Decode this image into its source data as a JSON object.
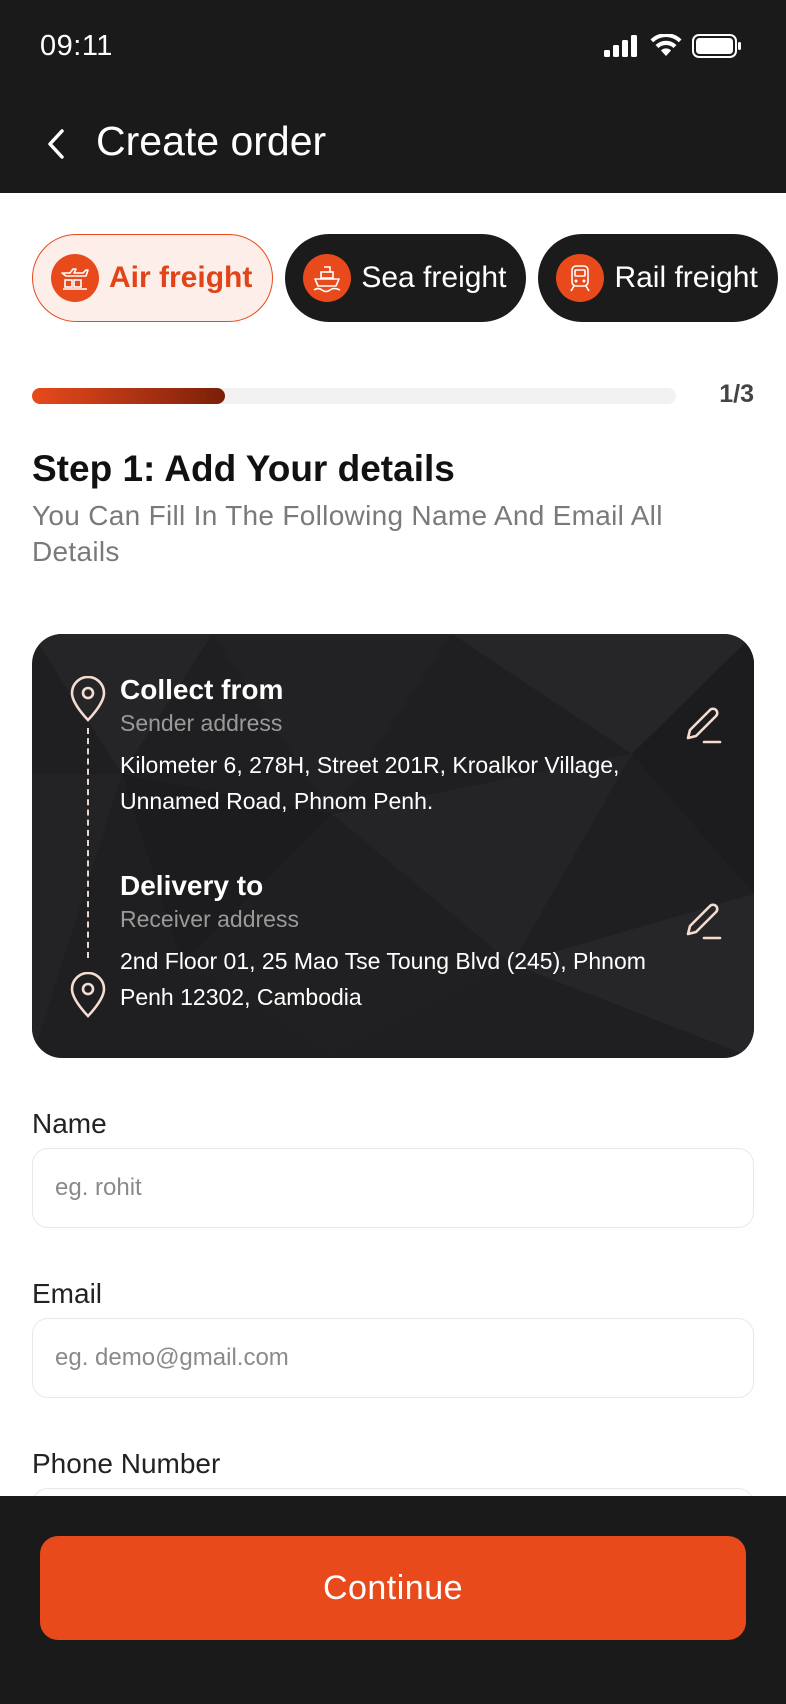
{
  "status_bar": {
    "time": "09:11"
  },
  "header": {
    "title": "Create order"
  },
  "tabs": [
    {
      "label": "Air freight",
      "active": true,
      "icon": "airplane-cargo-icon"
    },
    {
      "label": "Sea freight",
      "active": false,
      "icon": "ship-icon"
    },
    {
      "label": "Rail freight",
      "active": false,
      "icon": "train-icon"
    }
  ],
  "progress": {
    "text": "1/3",
    "fraction": 0.3
  },
  "step": {
    "title": "Step 1:  Add Your details",
    "subtitle": "You Can Fill In The Following Name And Email All Details"
  },
  "address": {
    "collect": {
      "heading": "Collect from",
      "label": "Sender address",
      "text": "Kilometer 6, 278H, Street 201R, Kroalkor Village, Unnamed Road, Phnom Penh."
    },
    "delivery": {
      "heading": "Delivery to",
      "label": "Receiver address",
      "text": "2nd Floor 01, 25 Mao Tse Toung Blvd (245), Phnom Penh 12302, Cambodia"
    }
  },
  "form": {
    "name": {
      "label": "Name",
      "placeholder": "eg. rohit"
    },
    "email": {
      "label": "Email",
      "placeholder": "eg. demo@gmail.com"
    },
    "phone": {
      "label": "Phone Number"
    }
  },
  "footer": {
    "continue_label": "Continue"
  },
  "colors": {
    "accent": "#e84a1c",
    "dark": "#1a1a1a",
    "active_tab_bg": "#fdeee9"
  }
}
